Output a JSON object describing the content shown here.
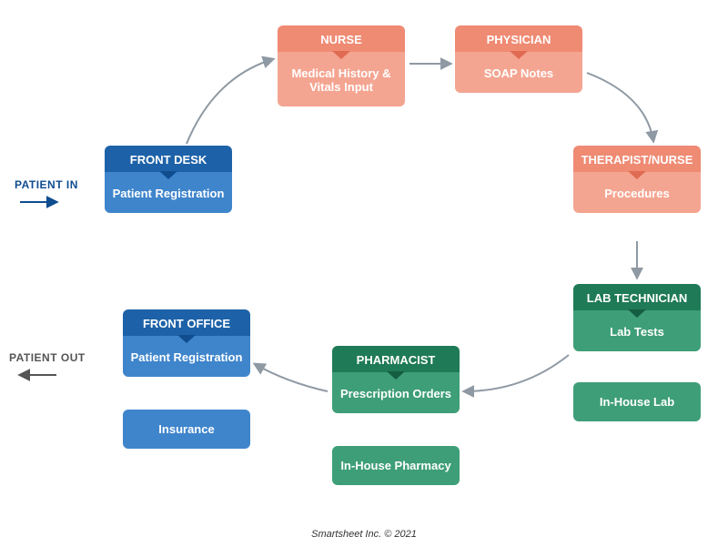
{
  "labels": {
    "patient_in": "PATIENT IN",
    "patient_out": "PATIENT OUT"
  },
  "nodes": {
    "front_desk": {
      "role": "FRONT DESK",
      "task": "Patient Registration"
    },
    "nurse": {
      "role": "NURSE",
      "task": "Medical History & Vitals Input"
    },
    "physician": {
      "role": "PHYSICIAN",
      "task": "SOAP Notes"
    },
    "therapist": {
      "role": "THERAPIST/NURSE",
      "task": "Procedures"
    },
    "lab_tech": {
      "role": "LAB TECHNICIAN",
      "task": "Lab Tests"
    },
    "pharmacist": {
      "role": "PHARMACIST",
      "task": "Prescription Orders"
    },
    "front_office": {
      "role": "FRONT OFFICE",
      "task": "Patient Registration"
    }
  },
  "cards": {
    "in_house_lab": "In-House Lab",
    "in_house_pharmacy": "In-House Pharmacy",
    "insurance": "Insurance"
  },
  "footer": "Smartsheet Inc. © 2021",
  "colors": {
    "blue_dark": "#1d62a8",
    "blue_light": "#3f85cc",
    "salmon_dark": "#ef8a73",
    "salmon_light": "#f4a591",
    "green_dark": "#1f7a57",
    "green_light": "#3e9e78",
    "arrow": "#8f99a3"
  }
}
